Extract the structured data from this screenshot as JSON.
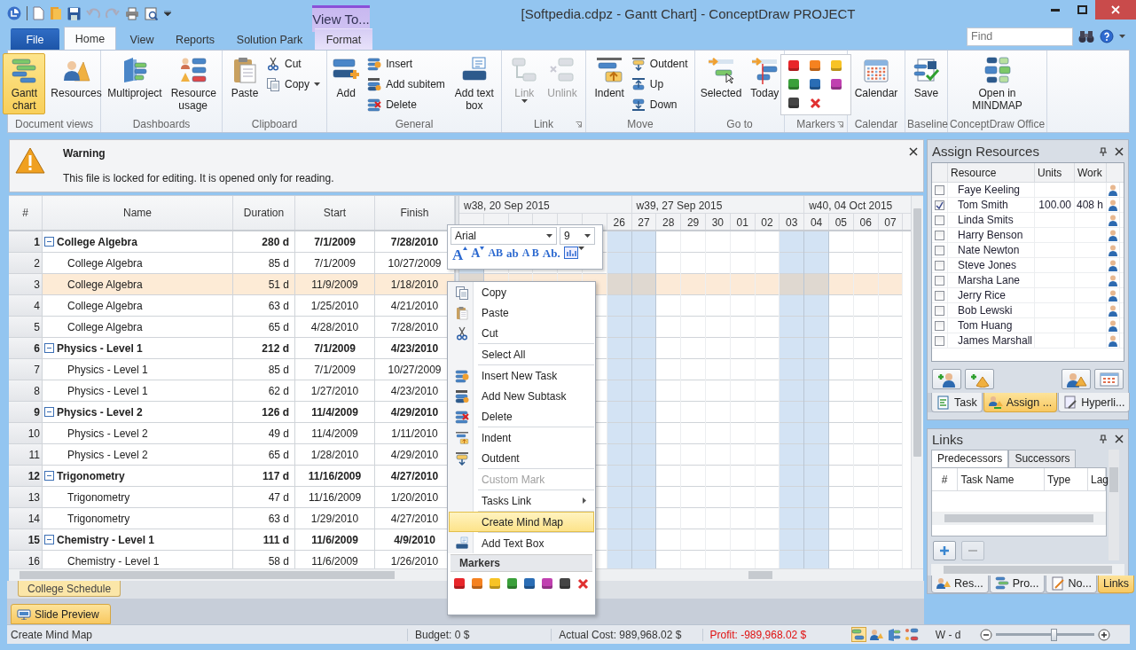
{
  "window": {
    "title": "[Softpedia.cdpz - Gantt Chart] - ConceptDraw PROJECT",
    "contextual_group": "View To..."
  },
  "ribbon": {
    "tabs": [
      {
        "label": "File",
        "kind": "file",
        "selected": false
      },
      {
        "label": "Home",
        "kind": "tab",
        "selected": true
      },
      {
        "label": "View",
        "kind": "tab",
        "selected": false
      },
      {
        "label": "Reports",
        "kind": "tab",
        "selected": false
      },
      {
        "label": "Solution Park",
        "kind": "tab",
        "selected": false
      },
      {
        "label": "Format",
        "kind": "contextual",
        "selected": false
      }
    ],
    "find": {
      "placeholder": "Find"
    },
    "groups": [
      {
        "label": "Document views",
        "items": [
          {
            "kind": "large",
            "label": "Gantt chart",
            "selected": true
          },
          {
            "kind": "large",
            "label": "Resources",
            "selected": false
          }
        ]
      },
      {
        "label": "Dashboards",
        "items": [
          {
            "kind": "large",
            "label": "Multiproject"
          },
          {
            "kind": "large",
            "label": "Resource usage"
          }
        ]
      },
      {
        "label": "Clipboard",
        "items": [
          {
            "kind": "large",
            "label": "Paste"
          },
          {
            "kind": "stack",
            "items": [
              {
                "label": "Cut"
              },
              {
                "label": "Copy",
                "dropdown": true
              }
            ]
          }
        ]
      },
      {
        "label": "General",
        "items": [
          {
            "kind": "large",
            "label": "Add"
          },
          {
            "kind": "stack",
            "items": [
              {
                "label": "Insert"
              },
              {
                "label": "Add subitem"
              },
              {
                "label": "Delete"
              }
            ]
          },
          {
            "kind": "large",
            "label": "Add text box"
          }
        ]
      },
      {
        "label": "Link",
        "launcher": true,
        "items": [
          {
            "kind": "large",
            "label": "Link",
            "disabled": true,
            "dropdown": true
          },
          {
            "kind": "large",
            "label": "Unlink",
            "disabled": true
          }
        ]
      },
      {
        "label": "Move",
        "items": [
          {
            "kind": "large",
            "label": "Indent"
          },
          {
            "kind": "stack",
            "items": [
              {
                "label": "Outdent"
              },
              {
                "label": "Up"
              },
              {
                "label": "Down"
              }
            ]
          }
        ]
      },
      {
        "label": "Go to",
        "items": [
          {
            "kind": "large",
            "label": "Selected"
          },
          {
            "kind": "large",
            "label": "Today"
          }
        ]
      },
      {
        "label": "Markers",
        "launcher": true,
        "items": [
          {
            "kind": "markers",
            "markers": [
              {
                "kind": "color",
                "color": "#e8262a"
              },
              {
                "kind": "color",
                "color": "#f58220"
              },
              {
                "kind": "color",
                "color": "#f7c325"
              },
              {
                "kind": "color",
                "color": "#3aa03a"
              },
              {
                "kind": "color",
                "color": "#2a6db5"
              },
              {
                "kind": "color",
                "color": "#c040b0"
              },
              {
                "kind": "color",
                "color": "#444444"
              },
              {
                "kind": "remove"
              }
            ]
          }
        ]
      },
      {
        "label": "Calendar",
        "items": [
          {
            "kind": "large",
            "label": "Calendar"
          }
        ]
      },
      {
        "label": "Baseline",
        "items": [
          {
            "kind": "large",
            "label": "Save"
          }
        ]
      },
      {
        "label": "ConceptDraw Office",
        "items": [
          {
            "kind": "large",
            "label": "Open in MINDMAP"
          }
        ]
      }
    ]
  },
  "warning": {
    "title": "Warning",
    "message": "This file is locked for editing. It is opened only for reading."
  },
  "table": {
    "columns": [
      "#",
      "Name",
      "Duration",
      "Start",
      "Finish"
    ],
    "tasks": [
      {
        "num": "1",
        "name": "College Algebra",
        "duration": "280 d",
        "start": "7/1/2009",
        "finish": "7/28/2010",
        "selected": false,
        "expanded": true,
        "children": [
          {
            "num": "2",
            "name": "College Algebra",
            "duration": "85 d",
            "start": "7/1/2009",
            "finish": "10/27/2009",
            "selected": false
          },
          {
            "num": "3",
            "name": "College Algebra",
            "duration": "51 d",
            "start": "11/9/2009",
            "finish": "1/18/2010",
            "selected": true
          },
          {
            "num": "4",
            "name": "College Algebra",
            "duration": "63 d",
            "start": "1/25/2010",
            "finish": "4/21/2010",
            "selected": false
          },
          {
            "num": "5",
            "name": "College Algebra",
            "duration": "65 d",
            "start": "4/28/2010",
            "finish": "7/28/2010",
            "selected": false
          }
        ]
      },
      {
        "num": "6",
        "name": "Physics - Level 1",
        "duration": "212 d",
        "start": "7/1/2009",
        "finish": "4/23/2010",
        "selected": false,
        "expanded": true,
        "children": [
          {
            "num": "7",
            "name": "Physics - Level 1",
            "duration": "85 d",
            "start": "7/1/2009",
            "finish": "10/27/2009",
            "selected": false
          },
          {
            "num": "8",
            "name": "Physics - Level 1",
            "duration": "62 d",
            "start": "1/27/2010",
            "finish": "4/23/2010",
            "selected": false
          }
        ]
      },
      {
        "num": "9",
        "name": "Physics - Level 2",
        "duration": "126 d",
        "start": "11/4/2009",
        "finish": "4/29/2010",
        "selected": false,
        "expanded": true,
        "children": [
          {
            "num": "10",
            "name": "Physics - Level 2",
            "duration": "49 d",
            "start": "11/4/2009",
            "finish": "1/11/2010",
            "selected": false
          },
          {
            "num": "11",
            "name": "Physics - Level 2",
            "duration": "65 d",
            "start": "1/28/2010",
            "finish": "4/29/2010",
            "selected": false
          }
        ]
      },
      {
        "num": "12",
        "name": "Trigonometry",
        "duration": "117 d",
        "start": "11/16/2009",
        "finish": "4/27/2010",
        "selected": false,
        "expanded": true,
        "children": [
          {
            "num": "13",
            "name": "Trigonometry",
            "duration": "47 d",
            "start": "11/16/2009",
            "finish": "1/20/2010",
            "selected": false
          },
          {
            "num": "14",
            "name": "Trigonometry",
            "duration": "63 d",
            "start": "1/29/2010",
            "finish": "4/27/2010",
            "selected": false
          }
        ]
      },
      {
        "num": "15",
        "name": "Chemistry - Level 1",
        "duration": "111 d",
        "start": "11/6/2009",
        "finish": "4/9/2010",
        "selected": false,
        "expanded": true,
        "children": [
          {
            "num": "16",
            "name": "Chemistry - Level 1",
            "duration": "58 d",
            "start": "11/6/2009",
            "finish": "1/26/2010",
            "selected": false
          }
        ]
      }
    ]
  },
  "timeline": {
    "weeks": [
      "w38, 20 Sep 2015",
      "w39, 27 Sep 2015",
      "w40, 04 Oct 2015"
    ],
    "days": [
      {
        "weekend": true
      },
      {
        "weekend": false
      },
      {
        "weekend": false
      },
      {
        "weekend": false
      },
      {
        "weekend": false
      },
      {
        "weekend": false
      },
      {
        "label": "26",
        "weekend": true
      },
      {
        "label": "27",
        "weekend": true
      },
      {
        "label": "28",
        "weekend": false
      },
      {
        "label": "29",
        "weekend": false
      },
      {
        "label": "30",
        "weekend": false
      },
      {
        "label": "01",
        "weekend": false
      },
      {
        "label": "02",
        "weekend": false
      },
      {
        "label": "03",
        "weekend": true
      },
      {
        "label": "04",
        "weekend": true
      },
      {
        "label": "05",
        "weekend": false
      },
      {
        "label": "06",
        "weekend": false
      },
      {
        "label": "07",
        "weekend": false
      }
    ]
  },
  "sheet_tabs": [
    {
      "label": "College Schedule",
      "selected": true
    }
  ],
  "bottom_tabs": [
    {
      "label": "Slide Preview",
      "selected": true
    }
  ],
  "format_toolbar": {
    "font": "Arial",
    "size": "9",
    "buttons": [
      "A",
      "A",
      "AB",
      "ab",
      "A B",
      "Ab."
    ]
  },
  "context_menu": {
    "items": [
      {
        "kind": "item",
        "label": "Copy",
        "selected": false,
        "disabled": false
      },
      {
        "kind": "item",
        "label": "Paste",
        "selected": false,
        "disabled": false
      },
      {
        "kind": "item",
        "label": "Cut",
        "selected": false,
        "disabled": false
      },
      {
        "kind": "separator"
      },
      {
        "kind": "item",
        "label": "Select All",
        "selected": false,
        "disabled": false
      },
      {
        "kind": "separator"
      },
      {
        "kind": "item",
        "label": "Insert New Task",
        "selected": false,
        "disabled": false
      },
      {
        "kind": "item",
        "label": "Add New Subtask",
        "selected": false,
        "disabled": false
      },
      {
        "kind": "item",
        "label": "Delete",
        "selected": false,
        "disabled": false
      },
      {
        "kind": "separator"
      },
      {
        "kind": "item",
        "label": "Indent",
        "selected": false,
        "disabled": false
      },
      {
        "kind": "item",
        "label": "Outdent",
        "selected": false,
        "disabled": false
      },
      {
        "kind": "separator"
      },
      {
        "kind": "item",
        "label": "Custom Mark",
        "selected": false,
        "disabled": true
      },
      {
        "kind": "separator"
      },
      {
        "kind": "item",
        "label": "Tasks Link",
        "selected": false,
        "disabled": false,
        "submenu": true
      },
      {
        "kind": "separator"
      },
      {
        "kind": "item",
        "label": "Create Mind Map",
        "selected": true,
        "disabled": false
      },
      {
        "kind": "separator"
      },
      {
        "kind": "item",
        "label": "Add Text Box",
        "selected": false,
        "disabled": false
      }
    ],
    "markers_title": "Markers",
    "markers": [
      {
        "kind": "color",
        "color": "#e8262a"
      },
      {
        "kind": "color",
        "color": "#f58220"
      },
      {
        "kind": "color",
        "color": "#f7c325"
      },
      {
        "kind": "color",
        "color": "#3aa03a"
      },
      {
        "kind": "color",
        "color": "#2a6db5"
      },
      {
        "kind": "color",
        "color": "#c040b0"
      },
      {
        "kind": "color",
        "color": "#444444"
      },
      {
        "kind": "remove"
      }
    ]
  },
  "assign_resources": {
    "title": "Assign Resources",
    "columns": [
      "Resource",
      "Units",
      "Work"
    ],
    "rows": [
      {
        "name": "Faye Keeling",
        "checked": false
      },
      {
        "name": "Tom Smith",
        "checked": true,
        "units": "100.00",
        "work": "408 h"
      },
      {
        "name": "Linda Smits",
        "checked": false
      },
      {
        "name": "Harry Benson",
        "checked": false
      },
      {
        "name": "Nate Newton",
        "checked": false
      },
      {
        "name": "Steve Jones",
        "checked": false
      },
      {
        "name": "Marsha Lane",
        "checked": false
      },
      {
        "name": "Jerry Rice",
        "checked": false
      },
      {
        "name": "Bob Lewski",
        "checked": false
      },
      {
        "name": "Tom Huang",
        "checked": false
      },
      {
        "name": "James Marshall",
        "checked": false
      }
    ],
    "tabs": [
      {
        "label": "Task",
        "selected": false
      },
      {
        "label": "Assign ...",
        "selected": true
      },
      {
        "label": "Hyperli...",
        "selected": false
      }
    ]
  },
  "links": {
    "title": "Links",
    "tabs": [
      {
        "label": "Predecessors",
        "selected": true
      },
      {
        "label": "Successors",
        "selected": false
      }
    ],
    "columns": [
      "#",
      "Task Name",
      "Type",
      "Lag"
    ],
    "remove_disabled": true,
    "bottom_tabs": [
      {
        "label": "Res...",
        "selected": false
      },
      {
        "label": "Pro...",
        "selected": false
      },
      {
        "label": "No...",
        "selected": false
      },
      {
        "label": "Links",
        "selected": true
      }
    ]
  },
  "status_bar": {
    "message": "Create Mind Map",
    "budget": "Budget: 0 $",
    "actual_cost": "Actual Cost: 989,968.02 $",
    "profit": "Profit: -989,968.02 $",
    "views": [
      {
        "selected": true
      },
      {
        "selected": false
      },
      {
        "selected": false
      },
      {
        "selected": false
      }
    ],
    "time_unit": "W - d",
    "zoom": {
      "level": 0.58
    }
  }
}
